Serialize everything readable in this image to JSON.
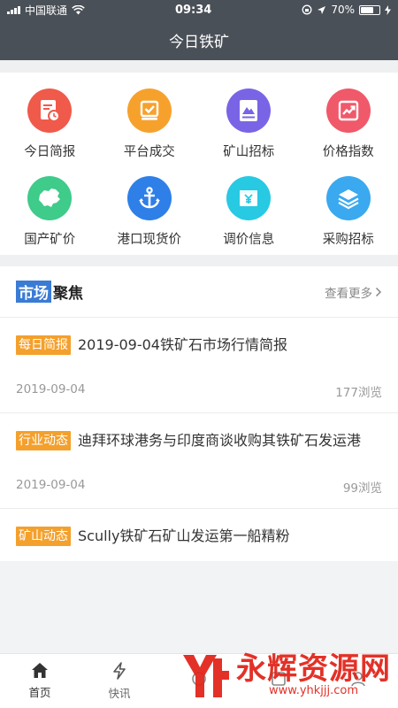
{
  "status_bar": {
    "carrier": "中国联通",
    "time": "09:34",
    "battery": "70%",
    "battery_level": 0.7
  },
  "nav": {
    "title": "今日铁矿"
  },
  "grid": [
    {
      "label": "今日简报",
      "icon": "calendar-report-icon",
      "color": "#f05a4a"
    },
    {
      "label": "平台成交",
      "icon": "checkmark-tray-icon",
      "color": "#f7a12d"
    },
    {
      "label": "矿山招标",
      "icon": "mountain-document-icon",
      "color": "#7a64e6"
    },
    {
      "label": "价格指数",
      "icon": "trend-chart-icon",
      "color": "#f0596a"
    },
    {
      "label": "国产矿价",
      "icon": "china-map-icon",
      "color": "#3fcb8a"
    },
    {
      "label": "港口现货价",
      "icon": "anchor-icon",
      "color": "#2f7fe8"
    },
    {
      "label": "调价信息",
      "icon": "yuan-price-icon",
      "color": "#28c9e2"
    },
    {
      "label": "采购招标",
      "icon": "layers-icon",
      "color": "#3aa9ef"
    }
  ],
  "market": {
    "title_highlight": "市场",
    "title_rest": "聚焦",
    "view_more": "查看更多"
  },
  "news": [
    {
      "tag": "每日简报",
      "title": "2019-09-04铁矿石市场行情简报",
      "date": "2019-09-04",
      "views": "177浏览"
    },
    {
      "tag": "行业动态",
      "title": "迪拜环球港务与印度商谈收购其铁矿石发运港",
      "date": "2019-09-04",
      "views": "99浏览"
    },
    {
      "tag": "矿山动态",
      "title": "Scully铁矿石矿山发运第一船精粉",
      "date": "",
      "views": ""
    }
  ],
  "tabs": [
    {
      "label": "首页",
      "icon": "home-icon",
      "active": true
    },
    {
      "label": "快讯",
      "icon": "lightning-icon",
      "active": false
    },
    {
      "label": "",
      "icon": "hidden-tab-icon",
      "active": false
    },
    {
      "label": "",
      "icon": "hidden-tab-icon",
      "active": false
    },
    {
      "label": "",
      "icon": "hidden-tab-icon",
      "active": false
    }
  ],
  "watermark": {
    "text": "永辉资源网",
    "url": "www.yhkjjj.com"
  },
  "colors": {
    "header": "#4a5058",
    "tag": "#f4a02c",
    "accent_blue": "#3a7bd5"
  }
}
